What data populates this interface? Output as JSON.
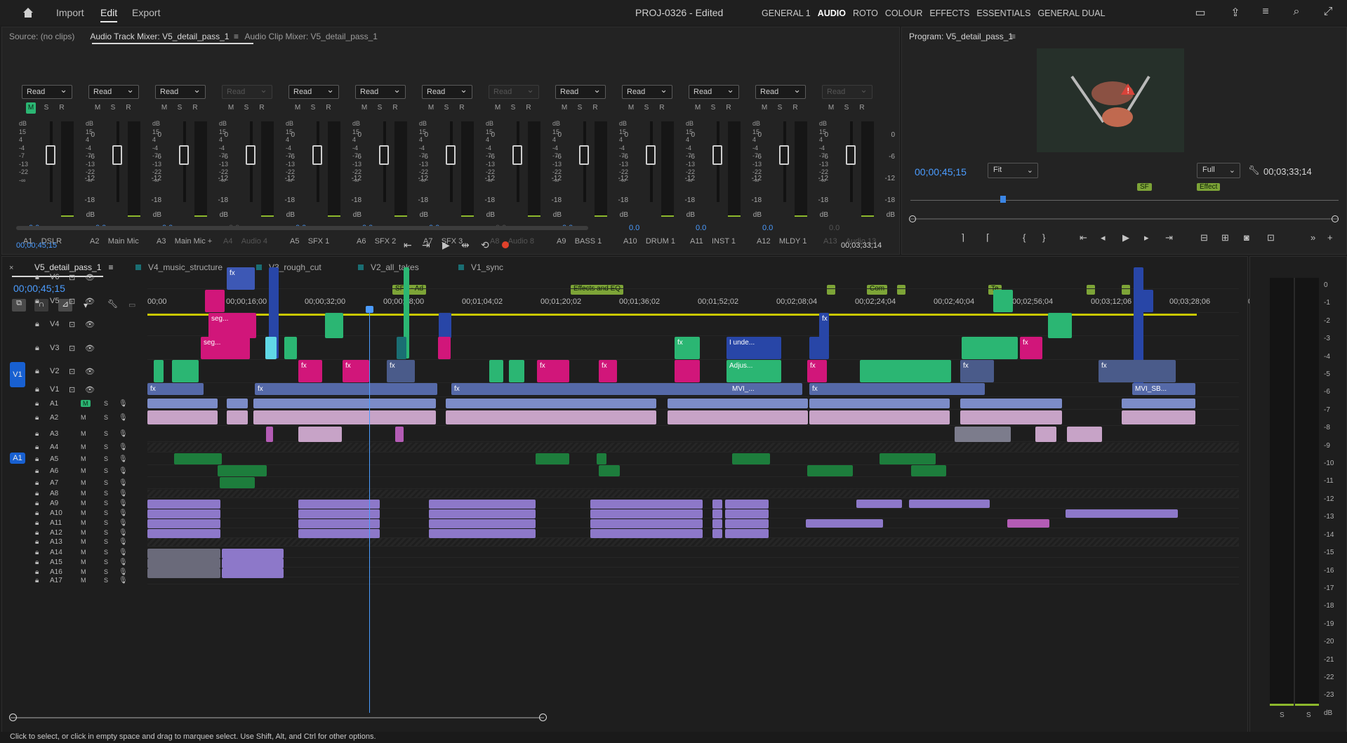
{
  "topbar": {
    "nav": [
      "Import",
      "Edit",
      "Export"
    ],
    "active_nav": "Edit",
    "project_title": "PROJ-0326 - Edited",
    "workspaces": [
      "GENERAL 1",
      "AUDIO",
      "ROTO",
      "COLOUR",
      "EFFECTS",
      "ESSENTIALS",
      "GENERAL DUAL"
    ],
    "active_workspace": "AUDIO",
    "icons": [
      "home-icon",
      "panel-layout-icon",
      "share-icon",
      "menu-icon",
      "search-icon",
      "expand-icon"
    ]
  },
  "mixer_panel": {
    "tabs": [
      "Source: (no clips)",
      "Audio Track Mixer: V5_detail_pass_1",
      "Audio Clip Mixer: V5_detail_pass_1"
    ],
    "active_tab": "Audio Track Mixer: V5_detail_pass_1",
    "read_label": "Read",
    "scale_left": [
      "dB",
      "15",
      "4",
      "-4",
      "-7",
      "-13",
      "-22",
      "-∞"
    ],
    "scale_right": [
      "0",
      "-6",
      "-12",
      "-18",
      "dB"
    ],
    "buttons": {
      "m": "M",
      "s": "S",
      "r": "R"
    },
    "tracks": [
      {
        "id": "A1",
        "name": "DSLR",
        "volume": "0.0",
        "disabled": false,
        "muted": true
      },
      {
        "id": "A2",
        "name": "Main Mic",
        "volume": "0.0",
        "disabled": false,
        "muted": false
      },
      {
        "id": "A3",
        "name": "Main Mic +",
        "volume": "0.0",
        "disabled": false,
        "muted": false
      },
      {
        "id": "A4",
        "name": "Audio 4",
        "volume": "0.0",
        "disabled": true,
        "muted": false
      },
      {
        "id": "A5",
        "name": "SFX 1",
        "volume": "0.0",
        "disabled": false,
        "muted": false
      },
      {
        "id": "A6",
        "name": "SFX 2",
        "volume": "0.0",
        "disabled": false,
        "muted": false
      },
      {
        "id": "A7",
        "name": "SFX 3",
        "volume": "0.0",
        "disabled": false,
        "muted": false
      },
      {
        "id": "A8",
        "name": "Audio 8",
        "volume": "0.0",
        "disabled": true,
        "muted": false
      },
      {
        "id": "A9",
        "name": "BASS 1",
        "volume": "0.0",
        "disabled": false,
        "muted": false
      },
      {
        "id": "A10",
        "name": "DRUM 1",
        "volume": "0.0",
        "disabled": false,
        "muted": false
      },
      {
        "id": "A11",
        "name": "INST 1",
        "volume": "0.0",
        "disabled": false,
        "muted": false
      },
      {
        "id": "A12",
        "name": "MLDY 1",
        "volume": "0.0",
        "disabled": false,
        "muted": false
      },
      {
        "id": "A13",
        "name": "Audio 13",
        "volume": "0.0",
        "disabled": true,
        "muted": false
      }
    ],
    "timecode_left": "00;00;45;15",
    "timecode_right": "00;03;33;14"
  },
  "program_monitor": {
    "title": "Program: V5_detail_pass_1",
    "timecode": "00;00;45;15",
    "fit_label": "Fit",
    "quality_label": "Full",
    "duration": "00;03;33;14",
    "marker_labels": [
      "SF",
      "Effect"
    ]
  },
  "timeline": {
    "sequence_tabs": [
      "V5_detail_pass_1",
      "V4_music_structure",
      "V3_rough_cut",
      "V2_all_takes",
      "V1_sync"
    ],
    "active_tab": "V5_detail_pass_1",
    "playhead_timecode": "00;00;45;15",
    "ruler": [
      "00;00",
      "00;00;16;00",
      "00;00;32;00",
      "00;00;48;00",
      "00;01;04;02",
      "00;01;20;02",
      "00;01;36;02",
      "00;01;52;02",
      "00;02;08;04",
      "00;02;24;04",
      "00;02;40;04",
      "00;02;56;04",
      "00;03;12;06",
      "00;03;28;06",
      "00;0"
    ],
    "markers": [
      "SFX - Ad",
      "E",
      "Effects and EQ",
      "Com",
      "Te"
    ],
    "video_tracks": [
      "V6",
      "V5",
      "V4",
      "V3",
      "V2",
      "V1"
    ],
    "source_patch_video": "V1",
    "source_patch_audio": "A1",
    "audio_tracks": [
      "A1",
      "A2",
      "A3",
      "A4",
      "A5",
      "A6",
      "A7",
      "A8",
      "A9",
      "A10",
      "A11",
      "A12",
      "A13",
      "A14",
      "A15",
      "A16",
      "A17"
    ],
    "clip_labels": {
      "seg1": "seg...",
      "seg2": "seg...",
      "unde": "I unde...",
      "adjus": "Adjus...",
      "mvi1": "MVI_...",
      "mvi2": "MVI_SB...",
      "fx": "fx"
    },
    "track_buttons": {
      "m": "M",
      "s": "S"
    },
    "meter_scale": [
      "0",
      "-1",
      "-2",
      "-3",
      "-4",
      "-5",
      "-6",
      "-7",
      "-8",
      "-9",
      "-10",
      "-11",
      "-12",
      "-13",
      "-14",
      "-15",
      "-16",
      "-17",
      "-18",
      "-19",
      "-20",
      "-21",
      "-22",
      "-23",
      "dB"
    ],
    "meter_solo": [
      "S",
      "S"
    ]
  },
  "status_bar": {
    "text": "Click to select, or click in empty space and drag to marquee select. Use Shift, Alt, and Ctrl for other options."
  }
}
